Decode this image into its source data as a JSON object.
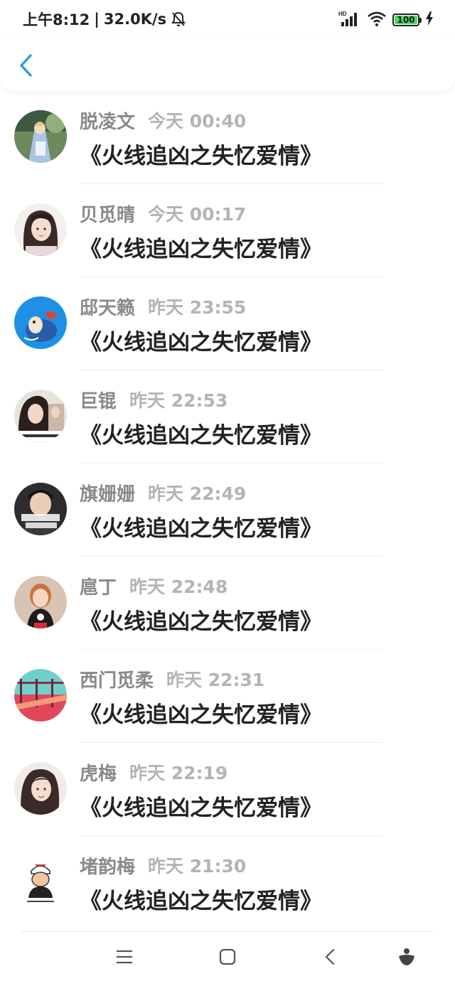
{
  "status_bar": {
    "time": "上午8:12",
    "separator": "|",
    "net_speed": "32.0K/s",
    "signal_label": "HD",
    "battery_level": "100",
    "icons": [
      "bell-muted-icon",
      "signal-icon",
      "wifi-icon",
      "battery-icon",
      "charging-icon"
    ]
  },
  "nav": {
    "back_icon": "chevron-left-icon"
  },
  "messages": [
    {
      "name": "脱凌文",
      "time": "今天 00:40",
      "text": "《火线追凶之失忆爱情》"
    },
    {
      "name": "贝觅晴",
      "time": "今天 00:17",
      "text": "《火线追凶之失忆爱情》"
    },
    {
      "name": "邸天籁",
      "time": "昨天 23:55",
      "text": "《火线追凶之失忆爱情》"
    },
    {
      "name": "巨锟",
      "time": "昨天 22:53",
      "text": "《火线追凶之失忆爱情》"
    },
    {
      "name": "旗姗姗",
      "time": "昨天 22:49",
      "text": "《火线追凶之失忆爱情》"
    },
    {
      "name": "扈丁",
      "time": "昨天 22:48",
      "text": "《火线追凶之失忆爱情》"
    },
    {
      "name": "西门觅柔",
      "time": "昨天 22:31",
      "text": "《火线追凶之失忆爱情》"
    },
    {
      "name": "虎梅",
      "time": "昨天 22:19",
      "text": "《火线追凶之失忆爱情》"
    },
    {
      "name": "堵韵梅",
      "time": "昨天 21:30",
      "text": "《火线追凶之失忆爱情》"
    }
  ],
  "bottom_nav": {
    "icons": [
      "menu-icon",
      "home-icon",
      "back-icon",
      "assistant-icon"
    ]
  },
  "colors": {
    "accent": "#2d9cdb",
    "name": "#8a8a8a",
    "time": "#b4b4b4",
    "message": "#222222",
    "battery": "#4cd964"
  }
}
